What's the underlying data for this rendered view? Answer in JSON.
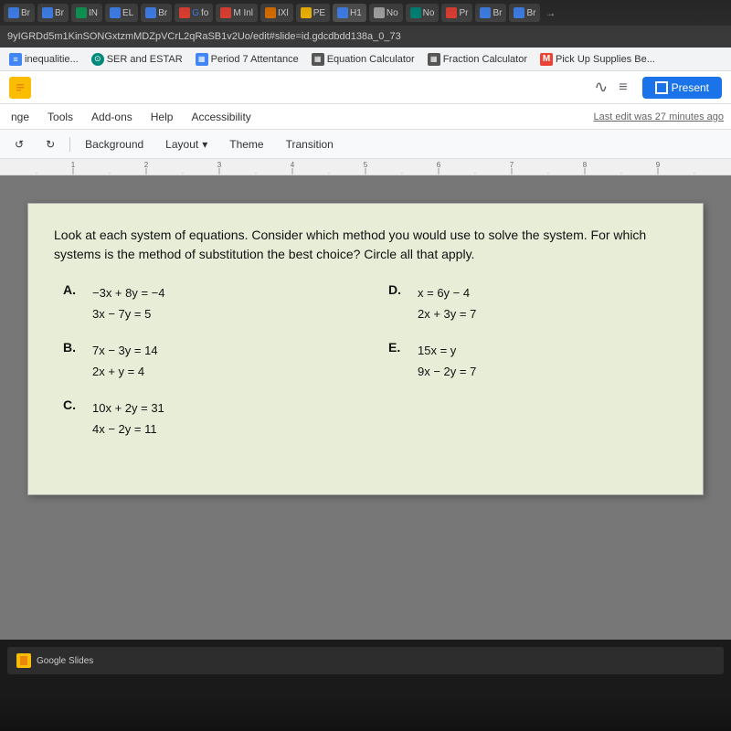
{
  "browser": {
    "tabs": [
      {
        "label": "Br",
        "color": "#4285f4",
        "active": false
      },
      {
        "label": "Br",
        "color": "#4285f4",
        "active": false
      },
      {
        "label": "IN",
        "color": "#0f9d58",
        "active": false
      },
      {
        "label": "EL",
        "color": "#4285f4",
        "active": false
      },
      {
        "label": "Br",
        "color": "#4285f4",
        "active": false
      },
      {
        "label": "fo",
        "color": "#ea4335",
        "active": false
      },
      {
        "label": "Inl",
        "color": "#d93025",
        "active": false
      },
      {
        "label": "IXl",
        "color": "#e37400",
        "active": false
      },
      {
        "label": "PE",
        "color": "#fbbc04",
        "active": false
      },
      {
        "label": "H1",
        "color": "#4285f4",
        "active": true
      },
      {
        "label": "No",
        "color": "#aaa",
        "active": false
      },
      {
        "label": "No",
        "color": "#00897b",
        "active": false
      },
      {
        "label": "Pr",
        "color": "#ea4335",
        "active": false
      },
      {
        "label": "Br",
        "color": "#4285f4",
        "active": false
      },
      {
        "label": "Br",
        "color": "#4285f4",
        "active": false
      }
    ],
    "url": "9yIGRDd5m1KinSONGxtzmMDZpVCrL2qRaSB1v2Uo/edit#slide=id.gdcdbdd138a_0_73"
  },
  "bookmarks": [
    {
      "label": "inequalitie...",
      "icon": "≡",
      "iconBg": "#4285f4"
    },
    {
      "label": "SER and ESTAR",
      "icon": "⊙",
      "iconBg": "#00897b"
    },
    {
      "label": "Period 7 Attentance",
      "icon": "▦",
      "iconBg": "#4285f4"
    },
    {
      "label": "Equation Calculator",
      "icon": "▦",
      "iconBg": "#666"
    },
    {
      "label": "Fraction Calculator",
      "icon": "▦",
      "iconBg": "#666"
    },
    {
      "label": "Pick Up Supplies Be...",
      "icon": "M",
      "iconBg": "#ea4335"
    }
  ],
  "slides": {
    "menu_items": [
      "nge",
      "Tools",
      "Add-ons",
      "Help",
      "Accessibility"
    ],
    "last_edit": "Last edit was 27 minutes ago",
    "toolbar": {
      "background": "Background",
      "layout": "Layout",
      "theme": "Theme",
      "transition": "Transition"
    },
    "present_btn": "Present",
    "slide": {
      "question": "Look at each system of equations. Consider which method you would use to solve the system.\nFor which systems is the method of substitution the best choice? Circle all that apply.",
      "equations": [
        {
          "label": "A.",
          "line1": "−3x + 8y = −4",
          "line2": "3x − 7y = 5"
        },
        {
          "label": "D.",
          "line1": "x = 6y − 4",
          "line2": "2x + 3y = 7"
        },
        {
          "label": "B.",
          "line1": "7x − 3y = 14",
          "line2": "2x + y = 4"
        },
        {
          "label": "E.",
          "line1": "15x = y",
          "line2": "9x − 2y = 7"
        },
        {
          "label": "C.",
          "line1": "10x + 2y = 31",
          "line2": "4x − 2y = 11"
        }
      ]
    }
  }
}
